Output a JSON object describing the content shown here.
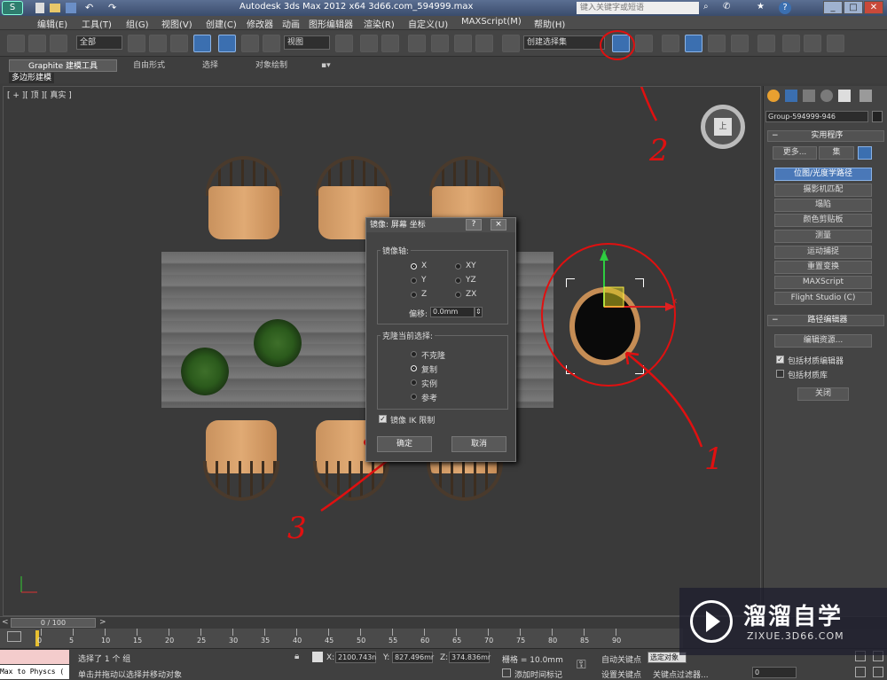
{
  "window": {
    "title": "Autodesk 3ds Max  2012 x64     3d66.com_594999.max",
    "search_placeholder": "键入关键字或短语"
  },
  "menu": [
    "编辑(E)",
    "工具(T)",
    "组(G)",
    "视图(V)",
    "创建(C)",
    "修改器",
    "动画",
    "图形编辑器",
    "渲染(R)",
    "自定义(U)",
    "MAXScript(M)",
    "帮助(H)"
  ],
  "toolbar": {
    "selection_filter": "全部",
    "reference_coord": "视图",
    "named_selection": "创建选择集"
  },
  "ribbon": {
    "tabs": [
      "Graphite 建模工具",
      "自由形式",
      "选择",
      "对象绘制"
    ],
    "subtab": "多边形建模"
  },
  "viewport": {
    "label": "[ + ][ 顶 ][ 真实 ]",
    "viewcube_face": "上"
  },
  "dialog": {
    "title": "镜像: 屏幕 坐标",
    "help_btn": "?",
    "close_btn": "×",
    "mirror_axis_label": "镜像轴:",
    "axes": [
      {
        "label": "X",
        "checked": true
      },
      {
        "label": "XY",
        "checked": false
      },
      {
        "label": "Y",
        "checked": false
      },
      {
        "label": "YZ",
        "checked": false
      },
      {
        "label": "Z",
        "checked": false
      },
      {
        "label": "ZX",
        "checked": false
      }
    ],
    "offset_label": "偏移:",
    "offset_value": "0.0mm",
    "clone_label": "克隆当前选择:",
    "clone_options": [
      {
        "label": "不克隆",
        "checked": false
      },
      {
        "label": "复制",
        "checked": true
      },
      {
        "label": "实例",
        "checked": false
      },
      {
        "label": "参考",
        "checked": false
      }
    ],
    "ik_label": "镜像 IK 限制",
    "ok": "确定",
    "cancel": "取消"
  },
  "command_panel": {
    "object_name": "Group-594999-946",
    "utilities_title": "实用程序",
    "more": "更多...",
    "sets": "集",
    "utilities": [
      "位图/光度学路径",
      "摄影机匹配",
      "塌陷",
      "颜色剪贴板",
      "测量",
      "运动捕捉",
      "重置变换",
      "MAXScript",
      "Flight Studio (C)"
    ],
    "path_editor_title": "路径编辑器",
    "edit_resources": "编辑资源...",
    "include_mat_editor": "包括材质编辑器",
    "include_mat_library": "包括材质库",
    "close": "关闭"
  },
  "timeline": {
    "frame": "0 / 100",
    "ticks": [
      "0",
      "5",
      "10",
      "15",
      "20",
      "25",
      "30",
      "35",
      "40",
      "45",
      "50",
      "55",
      "60",
      "65",
      "70",
      "75",
      "80",
      "85",
      "90"
    ]
  },
  "status": {
    "maxscript": "Max to Physcs (",
    "selected": "选择了 1 个 组",
    "prompt": "单击并拖动以选择并移动对象",
    "x_label": "X:",
    "x": "2100.743n",
    "y_label": "Y:",
    "y": "827.496mr",
    "z_label": "Z:",
    "z": "374.836mr",
    "grid": "栅格 = 10.0mm",
    "add_time_tag": "添加时间标记",
    "auto_key": "自动关键点",
    "set_key": "设置关键点",
    "selected_obj": "选定对象",
    "key_filters": "关键点过滤器...",
    "frame_value": "0"
  },
  "watermark": {
    "title": "溜溜自学",
    "url": "ZIXUE.3D66.COM"
  },
  "annotations": [
    "1",
    "2",
    "3"
  ]
}
